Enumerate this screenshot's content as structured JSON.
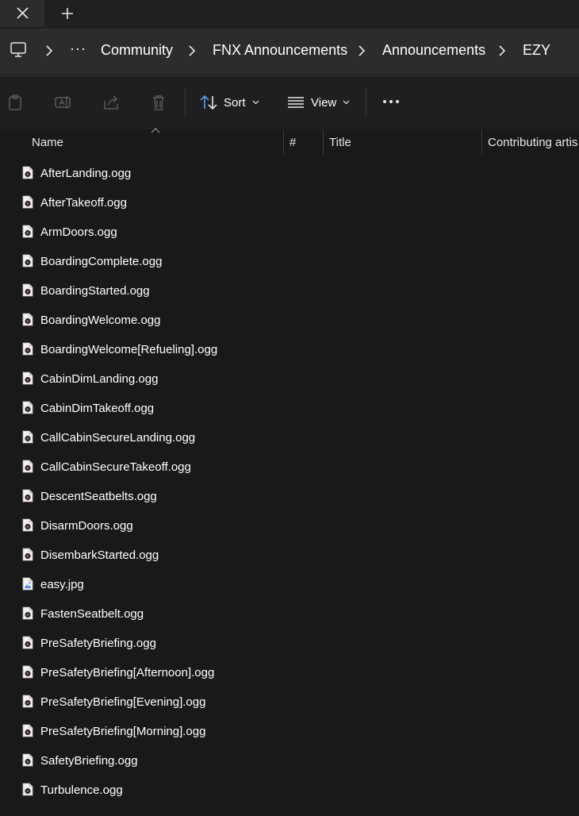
{
  "tabbar": {
    "close_icon": "close-icon",
    "new_tab_icon": "plus-icon"
  },
  "address": {
    "root_icon": "computer-icon",
    "overflow": "···",
    "crumbs": [
      "Community",
      "FNX Announcements",
      "Announcements",
      "EZY"
    ]
  },
  "toolbar": {
    "icons": [
      "paste-icon",
      "rename-icon",
      "share-icon",
      "delete-icon"
    ],
    "sort_label": "Sort",
    "view_label": "View",
    "more_icon": "more-icon"
  },
  "columns": [
    "Name",
    "#",
    "Title",
    "Contributing artis"
  ],
  "files": [
    {
      "name": "AfterLanding.ogg",
      "type": "audio"
    },
    {
      "name": "AfterTakeoff.ogg",
      "type": "audio"
    },
    {
      "name": "ArmDoors.ogg",
      "type": "audio"
    },
    {
      "name": "BoardingComplete.ogg",
      "type": "audio"
    },
    {
      "name": "BoardingStarted.ogg",
      "type": "audio"
    },
    {
      "name": "BoardingWelcome.ogg",
      "type": "audio"
    },
    {
      "name": "BoardingWelcome[Refueling].ogg",
      "type": "audio"
    },
    {
      "name": "CabinDimLanding.ogg",
      "type": "audio"
    },
    {
      "name": "CabinDimTakeoff.ogg",
      "type": "audio"
    },
    {
      "name": "CallCabinSecureLanding.ogg",
      "type": "audio"
    },
    {
      "name": "CallCabinSecureTakeoff.ogg",
      "type": "audio"
    },
    {
      "name": "DescentSeatbelts.ogg",
      "type": "audio"
    },
    {
      "name": "DisarmDoors.ogg",
      "type": "audio"
    },
    {
      "name": "DisembarkStarted.ogg",
      "type": "audio"
    },
    {
      "name": "easy.jpg",
      "type": "image"
    },
    {
      "name": "FastenSeatbelt.ogg",
      "type": "audio"
    },
    {
      "name": "PreSafetyBriefing.ogg",
      "type": "audio"
    },
    {
      "name": "PreSafetyBriefing[Afternoon].ogg",
      "type": "audio"
    },
    {
      "name": "PreSafetyBriefing[Evening].ogg",
      "type": "audio"
    },
    {
      "name": "PreSafetyBriefing[Morning].ogg",
      "type": "audio"
    },
    {
      "name": "SafetyBriefing.ogg",
      "type": "audio"
    },
    {
      "name": "Turbulence.ogg",
      "type": "audio"
    }
  ],
  "colors": {
    "accent_play": "#d4574e",
    "image_icon": "#3a8ee6",
    "background": "#191919"
  }
}
